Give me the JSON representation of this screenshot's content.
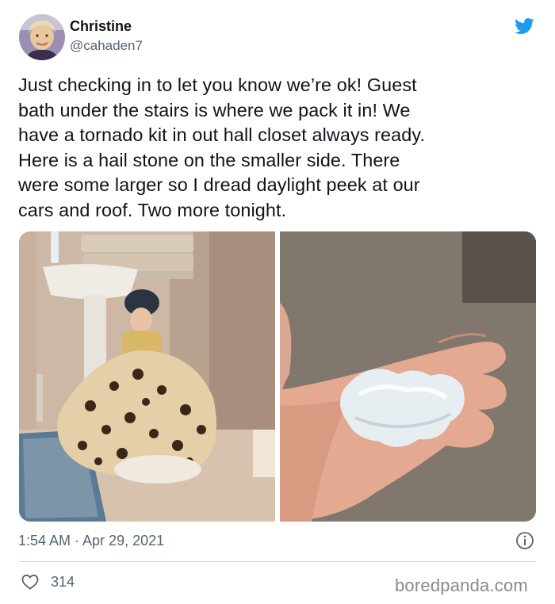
{
  "user": {
    "name": "Christine",
    "handle": "@cahaden7"
  },
  "tweet": {
    "text": "Just checking in to let you know we’re ok! Guest\nbath under the stairs is where we pack it in! We\nhave a tornado kit in out hall closet always ready.\nHere is a hail stone on the smaller side. There\nwere some larger so I dread daylight peek at our\ncars and roof. Two more tonight.",
    "timestamp": "1:54 AM · Apr 29, 2021",
    "likes": "314"
  },
  "icons": {
    "brand": "twitter-bird-icon",
    "info": "info-icon",
    "like": "heart-icon"
  },
  "colors": {
    "twitter_blue": "#1d9bf0",
    "secondary_text": "#536471"
  },
  "watermark": "boredpanda.com"
}
